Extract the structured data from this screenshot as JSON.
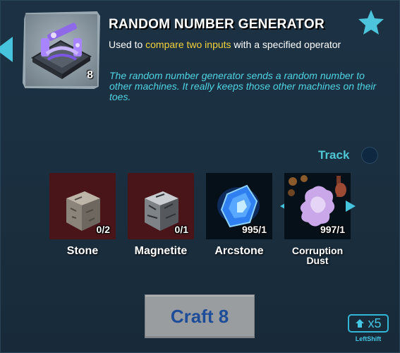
{
  "item": {
    "title": "RANDOM NUMBER GENERATOR",
    "quantity": "8",
    "subtitle_prefix": "Used to ",
    "subtitle_highlight": "compare two inputs",
    "subtitle_suffix": " with a specified operator",
    "description": "The random number generator sends a random number to other machines. It really keeps those other machines on their toes."
  },
  "track": {
    "label": "Track",
    "enabled": false
  },
  "ingredients": [
    {
      "name": "Stone",
      "count": "0/2",
      "status": "missing"
    },
    {
      "name": "Magnetite",
      "count": "0/1",
      "status": "missing"
    },
    {
      "name": "Arcstone",
      "count": "995/1",
      "status": "have"
    },
    {
      "name": "Corruption Dust",
      "count": "997/1",
      "status": "have"
    }
  ],
  "craft": {
    "label": "Craft 8"
  },
  "shortcut": {
    "multiplier": "x5",
    "key": "LeftShift"
  },
  "colors": {
    "accent": "#4fc6d4",
    "highlight": "#f3d33b",
    "missing_bg": "#4a1519",
    "craft_text": "#1d4c99"
  }
}
